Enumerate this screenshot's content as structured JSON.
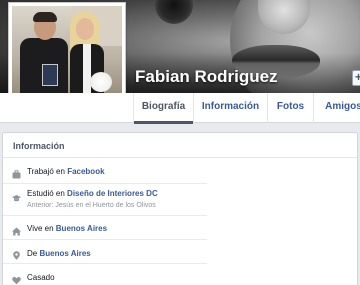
{
  "profile": {
    "name": "Fabian Rodriguez",
    "cover_button_glyph": "+"
  },
  "tabs": [
    {
      "label": "Biografía",
      "active": true
    },
    {
      "label": "Información",
      "active": false
    },
    {
      "label": "Fotos",
      "active": false
    },
    {
      "label": "Amigos",
      "active": false
    }
  ],
  "info": {
    "title": "Información",
    "items": [
      {
        "icon": "briefcase-icon",
        "prefix": "Trabajó en",
        "link": "Facebook",
        "sub": ""
      },
      {
        "icon": "graduation-icon",
        "prefix": "Estudió en",
        "link": "Diseño de Interiores DC",
        "sub": "Anterior: Jesús en el Huerto de los Olivos"
      },
      {
        "icon": "home-icon",
        "prefix": "Vive en",
        "link": "Buenos Aires",
        "sub": ""
      },
      {
        "icon": "location-pin-icon",
        "prefix": "De",
        "link": "Buenos Aires",
        "sub": ""
      },
      {
        "icon": "heart-icon",
        "prefix": "Casado",
        "link": "",
        "sub": ""
      }
    ]
  },
  "colors": {
    "link": "#3b5998",
    "text": "#141823",
    "muted": "#90949c",
    "page_bg": "#e9eaed"
  }
}
